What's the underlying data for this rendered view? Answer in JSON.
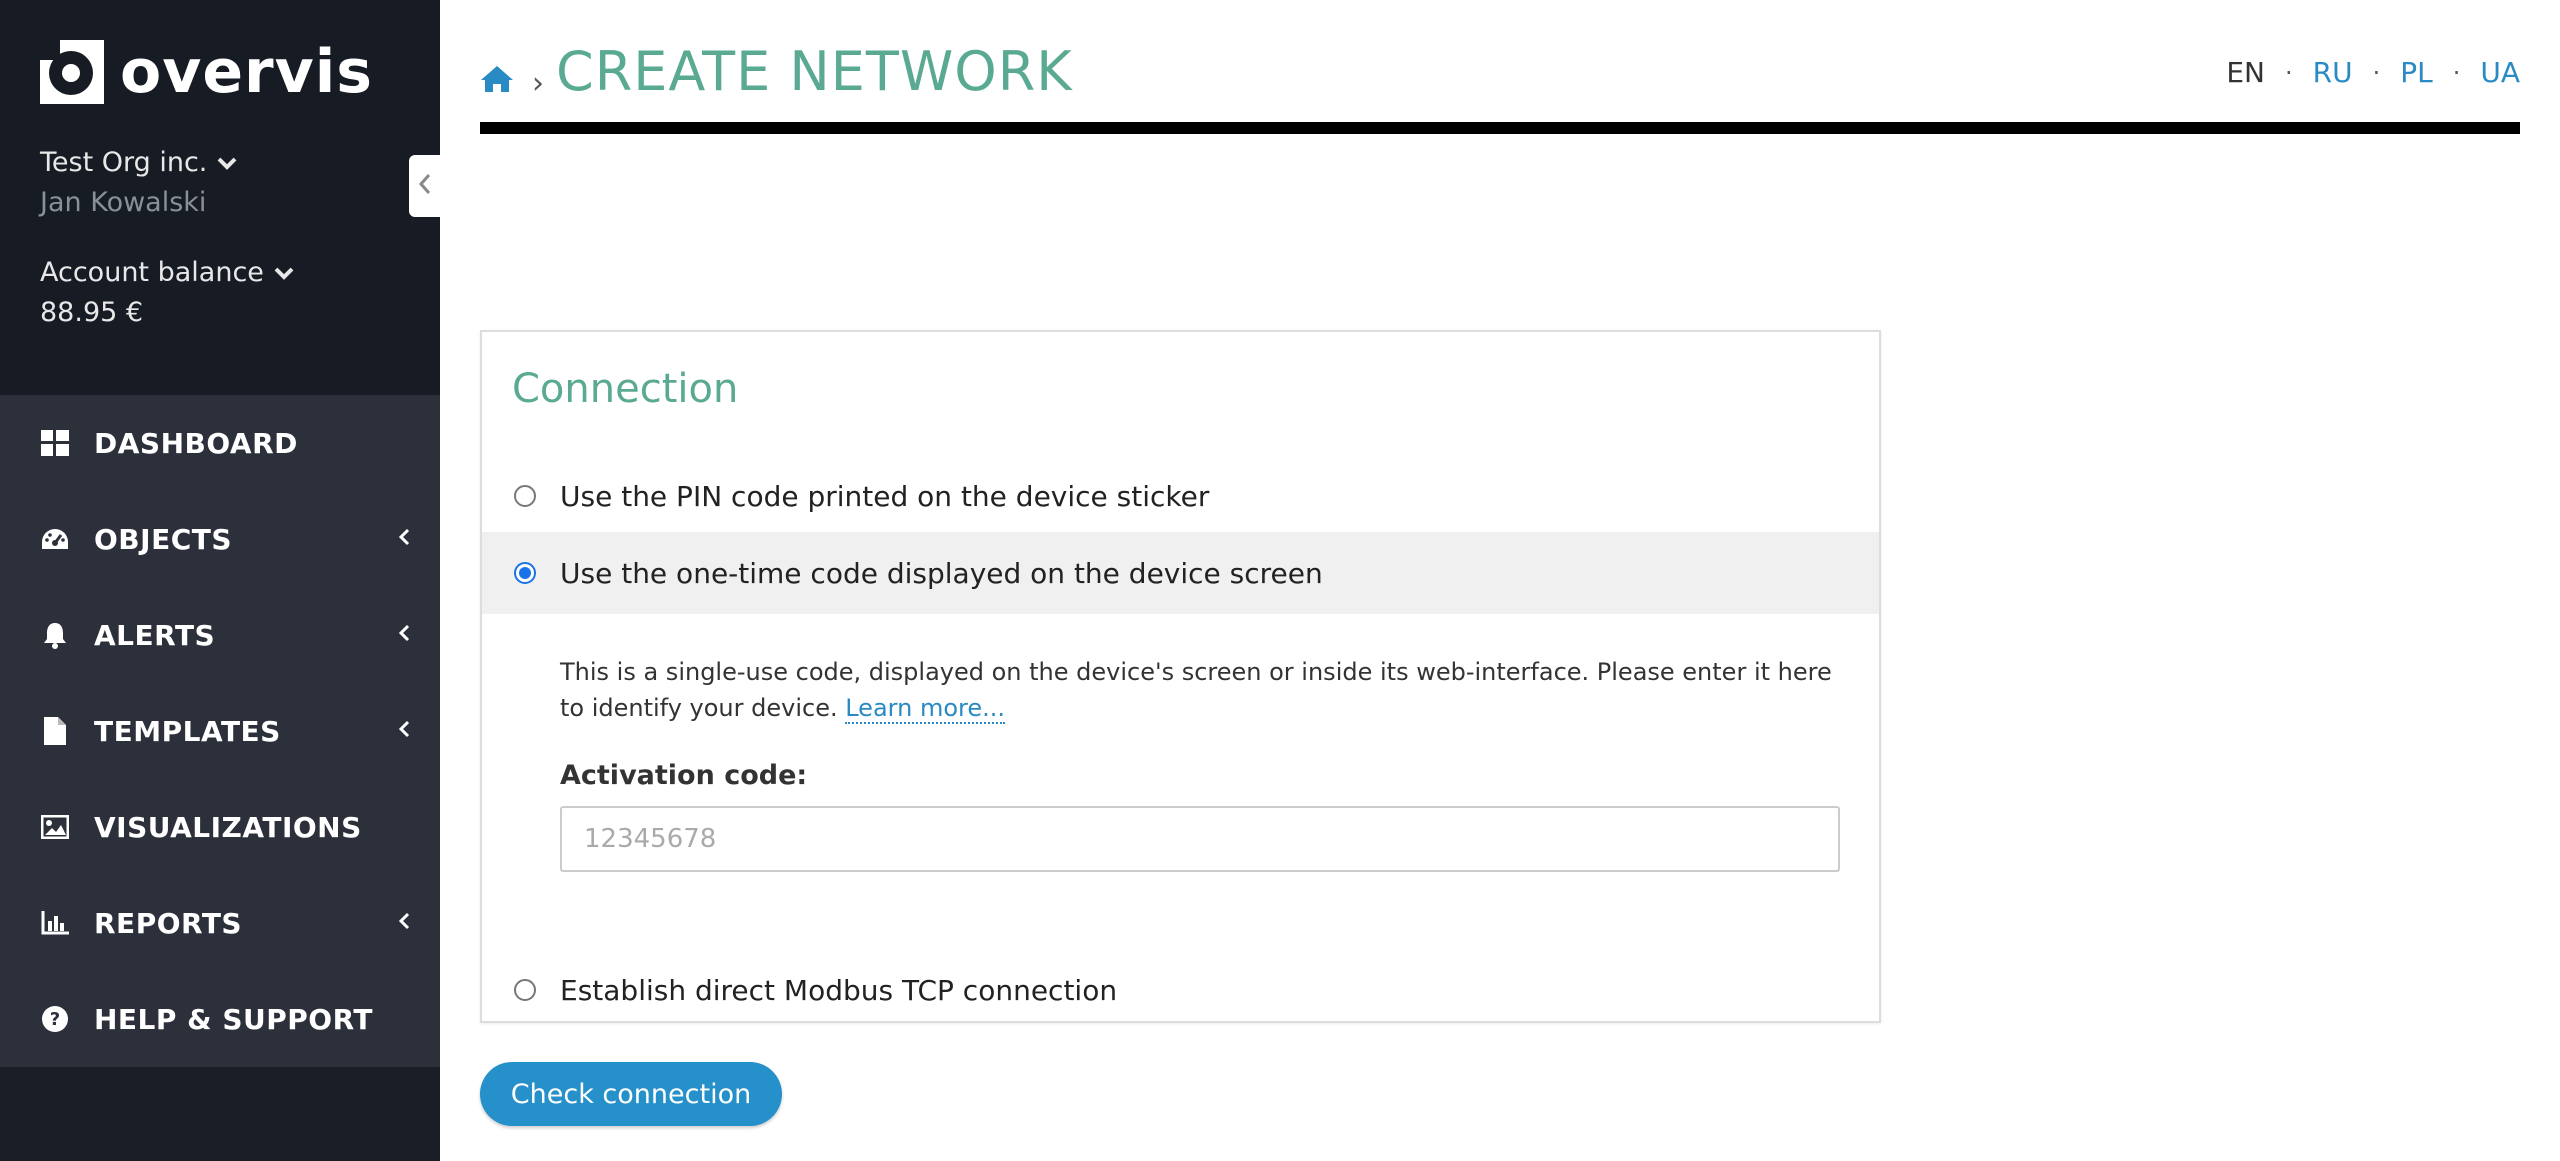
{
  "app": {
    "logo_text": "overvis"
  },
  "sidebar": {
    "org_name": "Test Org inc.",
    "user_name": "Jan Kowalski",
    "balance_label": "Account balance",
    "balance_value": "88.95 €",
    "items": [
      {
        "label": "DASHBOARD",
        "icon": "dashboard-icon",
        "has_submenu": false
      },
      {
        "label": "OBJECTS",
        "icon": "gauge-icon",
        "has_submenu": true
      },
      {
        "label": "ALERTS",
        "icon": "bell-icon",
        "has_submenu": true
      },
      {
        "label": "TEMPLATES",
        "icon": "file-icon",
        "has_submenu": true
      },
      {
        "label": "VISUALIZATIONS",
        "icon": "image-icon",
        "has_submenu": false
      },
      {
        "label": "REPORTS",
        "icon": "bar-chart-icon",
        "has_submenu": true
      },
      {
        "label": "HELP & SUPPORT",
        "icon": "question-circle-icon",
        "has_submenu": false
      }
    ]
  },
  "header": {
    "breadcrumb_separator": "›",
    "title": "CREATE NETWORK",
    "languages": [
      {
        "code": "EN",
        "active": true
      },
      {
        "code": "RU",
        "active": false
      },
      {
        "code": "PL",
        "active": false
      },
      {
        "code": "UA",
        "active": false
      }
    ],
    "language_separator": "·"
  },
  "connection": {
    "title": "Connection",
    "options": [
      {
        "label": "Use the PIN code printed on the device sticker",
        "selected": false
      },
      {
        "label": "Use the one-time code displayed on the device screen",
        "selected": true
      },
      {
        "label": "Establish direct Modbus TCP connection",
        "selected": false
      }
    ],
    "help_text": "This is a single-use code, displayed on the device's screen or inside its web-interface. Please enter it here to identify your device.",
    "learn_more": "Learn more...",
    "activation_label": "Activation code:",
    "activation_value": "",
    "activation_placeholder": "12345678"
  },
  "actions": {
    "check_connection": "Check connection"
  },
  "colors": {
    "accent": "#5aaa93",
    "link": "#2a8ac4",
    "button": "#2590c9",
    "sidebar_bg": "#161b24",
    "nav_bg": "#2b303a"
  }
}
